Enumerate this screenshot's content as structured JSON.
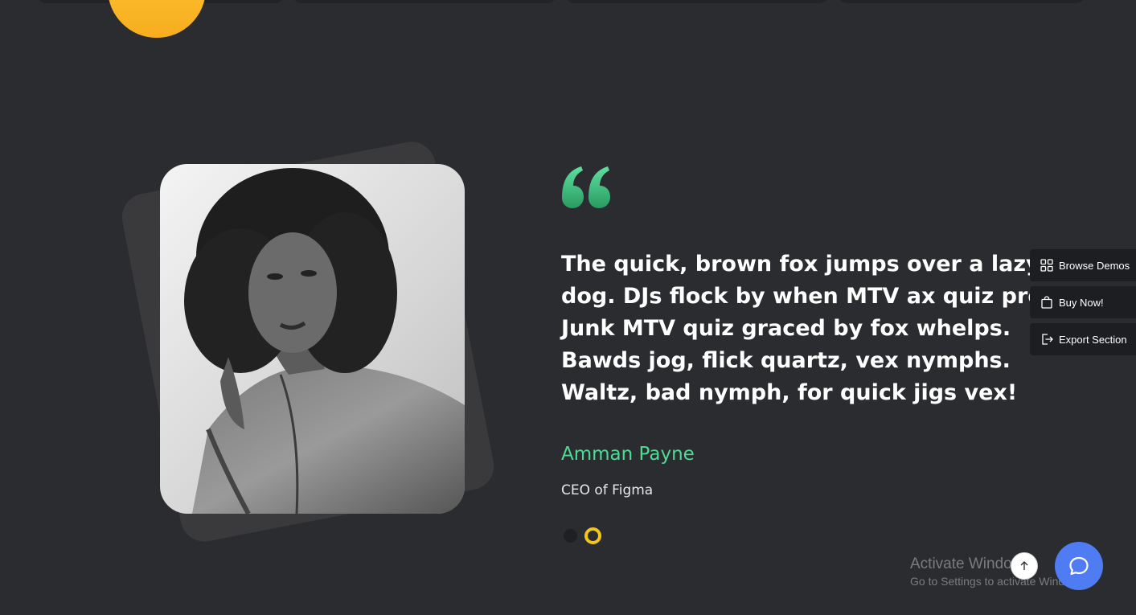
{
  "testimonial": {
    "quote": "The quick, brown fox jumps over a lazy dog. DJs flock by when MTV ax quiz prog. Junk MTV quiz graced by fox whelps. Bawds jog, flick quartz, vex nymphs. Waltz, bad nymph, for quick jigs vex!",
    "author": "Amman Payne",
    "role": "CEO of Figma",
    "slides_total": 2,
    "active_slide": 2
  },
  "side_panel": {
    "browse_demos": "Browse Demos",
    "buy_now": "Buy Now!",
    "export_section": "Export Section"
  },
  "watermark": {
    "title": "Activate Windows",
    "subtitle": "Go to Settings to activate Windows."
  },
  "colors": {
    "background": "#2b2c30",
    "accent_green": "#4ddc95",
    "accent_yellow": "#f5c518",
    "chat_blue": "#4f7cf2"
  },
  "icons": {
    "quote": "quote-icon",
    "browse_demos": "grid-icon",
    "buy_now": "shopping-bag-icon",
    "export_section": "export-icon",
    "scroll_top": "arrow-up-icon",
    "chat": "chat-bubble-icon"
  }
}
